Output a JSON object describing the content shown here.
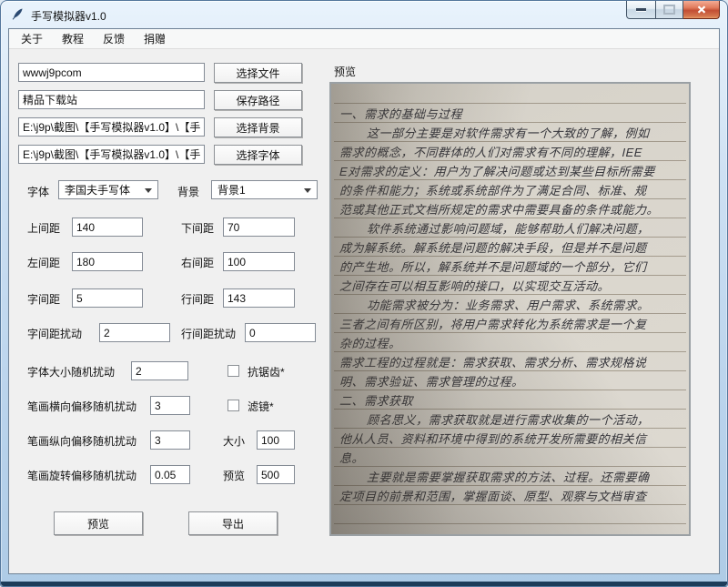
{
  "window": {
    "title": "手写模拟器v1.0"
  },
  "menu": {
    "items": [
      "关于",
      "教程",
      "反馈",
      "捐赠"
    ]
  },
  "file_rows": [
    {
      "value": "wwwj9pcom",
      "button": "选择文件"
    },
    {
      "value": "精品下载站",
      "button": "保存路径"
    },
    {
      "value": "E:\\j9p\\截图\\【手写模拟器v1.0】\\【手",
      "button": "选择背景"
    },
    {
      "value": "E:\\j9p\\截图\\【手写模拟器v1.0】\\【手",
      "button": "选择字体"
    }
  ],
  "settings": {
    "font": {
      "label": "字体",
      "value": "李国夫手写体"
    },
    "background": {
      "label": "背景",
      "value": "背景1"
    },
    "spacing_top": {
      "label": "上间距",
      "value": "140"
    },
    "spacing_bottom": {
      "label": "下间距",
      "value": "70"
    },
    "spacing_left": {
      "label": "左间距",
      "value": "180"
    },
    "spacing_right": {
      "label": "右间距",
      "value": "100"
    },
    "char_spacing": {
      "label": "字间距",
      "value": "5"
    },
    "line_spacing": {
      "label": "行间距",
      "value": "143"
    },
    "char_spacing_jitter": {
      "label": "字间距扰动",
      "value": "2"
    },
    "line_spacing_jitter": {
      "label": "行间距扰动",
      "value": "0"
    },
    "font_size_jitter": {
      "label": "字体大小随机扰动",
      "value": "2"
    },
    "antialias": {
      "label": "抗锯齿*",
      "checked": false
    },
    "stroke_h_jitter": {
      "label": "笔画横向偏移随机扰动",
      "value": "3"
    },
    "filter": {
      "label": "滤镜*",
      "checked": false
    },
    "stroke_v_jitter": {
      "label": "笔画纵向偏移随机扰动",
      "value": "3"
    },
    "size": {
      "label": "大小",
      "value": "100"
    },
    "stroke_rot_jitter": {
      "label": "笔画旋转偏移随机扰动",
      "value": "0.05"
    },
    "preview_size": {
      "label": "预览",
      "value": "500"
    }
  },
  "actions": {
    "preview": "预览",
    "export": "导出"
  },
  "preview_panel": {
    "title": "预览",
    "lines": [
      "一、需求的基础与过程",
      "这一部分主要是对软件需求有一个大致的了解，例如",
      "需求的概念，不同群体的人们对需求有不同的理解，IEE",
      "E对需求的定义：用户为了解决问题或达到某些目标所需要",
      "的条件和能力；系统或系统部件为了满足合同、标准、规",
      "范或其他正式文档所规定的需求中需要具备的条件或能力。",
      "软件系统通过影响问题域，能够帮助人们解决问题，",
      "成为解系统。解系统是问题的解决手段，但是并不是问题",
      "的产生地。所以，解系统并不是问题域的一个部分，它们",
      "之间存在可以相互影响的接口，以实现交互活动。",
      "功能需求被分为：业务需求、用户需求、系统需求。",
      "三者之间有所区别，将用户需求转化为系统需求是一个复",
      "杂的过程。",
      "需求工程的过程就是：需求获取、需求分析、需求规格说",
      "明、需求验证、需求管理的过程。",
      "二、需求获取",
      "顾名思义，需求获取就是进行需求收集的一个活动，",
      "他从人员、资料和环境中得到的系统开发所需要的相关信",
      "息。",
      "主要就是需要掌握获取需求的方法、过程。还需要确",
      "定项目的前景和范围，掌握面谈、原型、观察与文档审查"
    ]
  },
  "colors": {
    "titlebar_glass": "#cde0f3",
    "frame_border": "#54779c",
    "client_bg": "#f0f0f0",
    "close_button_red": "#c24e33",
    "paper": "#d9d5cc",
    "ink": "#35353b"
  }
}
